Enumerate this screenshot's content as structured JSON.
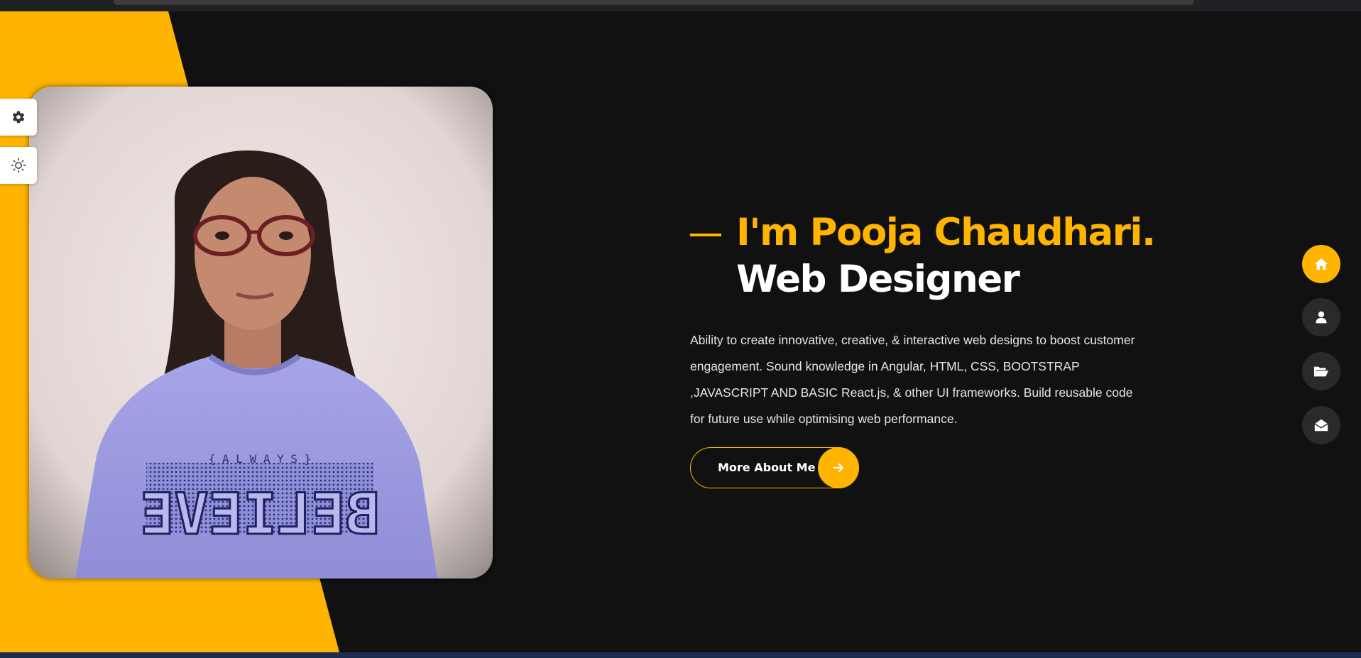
{
  "hero": {
    "name_line": "I'm Pooja Chaudhari.",
    "role_line": "Web Designer",
    "description": "Ability to create innovative, creative, & interactive web designs to boost customer engagement. Sound knowledge in Angular, HTML, CSS, BOOTSTRAP ,JAVASCRIPT AND BASIC React.js, & other UI frameworks. Build reusable code for future use while optimising web performance.",
    "cta_label": "More About Me",
    "cta_icon": "arrow-right-icon"
  },
  "photo": {
    "shirt_small_text": "{ A L W A Y S }",
    "shirt_main_text": "BELIEVE"
  },
  "side_panel": {
    "settings_icon": "gear-icon",
    "theme_icon": "sun-icon"
  },
  "nav": [
    {
      "icon": "home-icon",
      "active": true
    },
    {
      "icon": "user-icon",
      "active": false
    },
    {
      "icon": "folder-open-icon",
      "active": false
    },
    {
      "icon": "envelope-open-icon",
      "active": false
    }
  ],
  "colors": {
    "accent": "#ffb400",
    "background": "#111111",
    "nav_inactive": "#2b2a2a",
    "text_light": "#e6e6e6"
  }
}
